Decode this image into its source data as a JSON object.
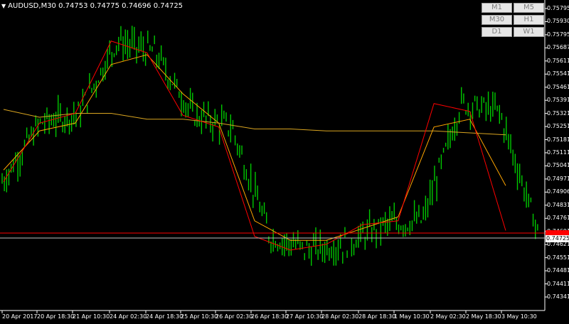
{
  "title": {
    "triangle": "▼",
    "text": "AUDUSD,M30  0.74753 0.74775 0.74696 0.74725"
  },
  "timeframes": [
    {
      "label": "M1"
    },
    {
      "label": "M5"
    },
    {
      "label": "M30"
    },
    {
      "label": "H1"
    },
    {
      "label": "D1"
    },
    {
      "label": "W1"
    }
  ],
  "price_axis": [
    "0.75795",
    "0.75930",
    "0.75795",
    "0.75687",
    "0.75611",
    "0.75541",
    "0.75461",
    "0.75391",
    "0.75321",
    "0.75251",
    "0.75181",
    "0.75041",
    "0.74971",
    "0.74901",
    "0.74831",
    "0.74761",
    "0.74691",
    "0.74621",
    "0.74551",
    "0.74481",
    "0.74411",
    "0.74341"
  ],
  "price_labels": [
    "0.75795",
    "0.75930",
    "0.75795",
    "0.75687",
    "0.75611",
    "0.75541",
    "0.75461",
    "0.75391",
    "0.75321",
    "0.75251",
    "0.75181",
    "0.75111",
    "0.75041",
    "0.74971",
    "0.74906",
    "0.74831",
    "0.74761",
    "0.74691",
    "0.74621",
    "0.74551",
    "0.74481",
    "0.74411",
    "0.74341"
  ],
  "axis_prices": [
    "0.75795",
    "0.75930",
    "0.75795",
    "0.75687",
    "0.75611",
    "0.75541",
    "0.75461",
    "0.75391",
    "0.75321",
    "0.75251",
    "0.75181",
    "0.75111",
    "0.75041",
    "0.74971",
    "0.74906",
    "0.74831",
    "0.74761",
    "0.74691",
    "0.74621",
    "0.74551",
    "0.74481",
    "0.74411",
    "0.74341"
  ],
  "y_axis": {
    "labels": [
      "0.75795",
      "0.75930",
      "0.75795",
      "0.75687",
      "0.75611",
      "0.75541",
      "0.75461",
      "0.75391",
      "0.75321",
      "0.75251",
      "0.75181",
      "0.75111",
      "0.75041",
      "0.74971",
      "0.74906",
      "0.74831",
      "0.74761",
      "0.74691",
      "0.74621",
      "0.74551",
      "0.74481",
      "0.74411",
      "0.74341"
    ]
  },
  "axis": {
    "prices": [
      "0.75795",
      "0.75930",
      "0.75795",
      "0.75687",
      "0.75611",
      "0.75541",
      "0.75461",
      "0.75391",
      "0.75321",
      "0.75251",
      "0.75181",
      "0.75111",
      "0.75041",
      "0.74971",
      "0.74906",
      "0.74831",
      "0.74761",
      "0.74691",
      "0.74621",
      "0.74551",
      "0.74481",
      "0.74411",
      "0.74341"
    ],
    "times": [
      "20 Apr 2017",
      "20 Apr 18:30",
      "21 Apr 10:30",
      "24 Apr 02:30",
      "24 Apr 18:30",
      "25 Apr 10:30",
      "26 Apr 02:30",
      "26 Apr 18:30",
      "27 Apr 10:30",
      "28 Apr 02:30",
      "28 Apr 18:30",
      "1 May 10:30",
      "2 May 02:30",
      "2 May 18:30",
      "3 May 10:30"
    ]
  },
  "current_price": {
    "bid": "0.74725",
    "line_color": "#c0c0c0"
  },
  "red_level": {
    "color": "#ff0000"
  },
  "colors": {
    "background": "#000000",
    "candles": "#00c800",
    "ma_fast": "#ff0000",
    "ma_medium": "#ffa500",
    "ma_slow": "#daa520"
  },
  "chart_data": {
    "type": "line",
    "symbol": "AUDUSD",
    "timeframe": "M30",
    "x": [
      "20 Apr 2017",
      "20 Apr 18:30",
      "21 Apr 10:30",
      "24 Apr 02:30",
      "24 Apr 18:30",
      "25 Apr 10:30",
      "26 Apr 02:30",
      "26 Apr 18:30",
      "27 Apr 10:30",
      "28 Apr 02:30",
      "28 Apr 18:30",
      "1 May 10:30",
      "2 May 02:30",
      "2 May 18:30",
      "3 May 10:30"
    ],
    "series": [
      {
        "values": [
          0.75,
          0.753,
          0.7535,
          0.7572,
          0.7566,
          0.7534,
          0.7528,
          0.7472,
          0.7465,
          0.7468,
          0.7478,
          0.748,
          0.754,
          0.7536,
          0.7475
        ]
      },
      {
        "values": [
          0.7506,
          0.7526,
          0.753,
          0.756,
          0.7565,
          0.7545,
          0.753,
          0.748,
          0.747,
          0.747,
          0.7476,
          0.7482,
          0.7528,
          0.7532,
          0.7498
        ]
      },
      {
        "values": [
          0.7537,
          0.7533,
          0.7535,
          0.7535,
          0.7532,
          0.7532,
          0.753,
          0.7527,
          0.7527,
          0.7526,
          0.7526,
          0.7526,
          0.7526,
          0.7525,
          0.7524
        ]
      }
    ],
    "ylim": [
      0.74341,
      0.7593
    ],
    "last_price": 0.74725
  }
}
